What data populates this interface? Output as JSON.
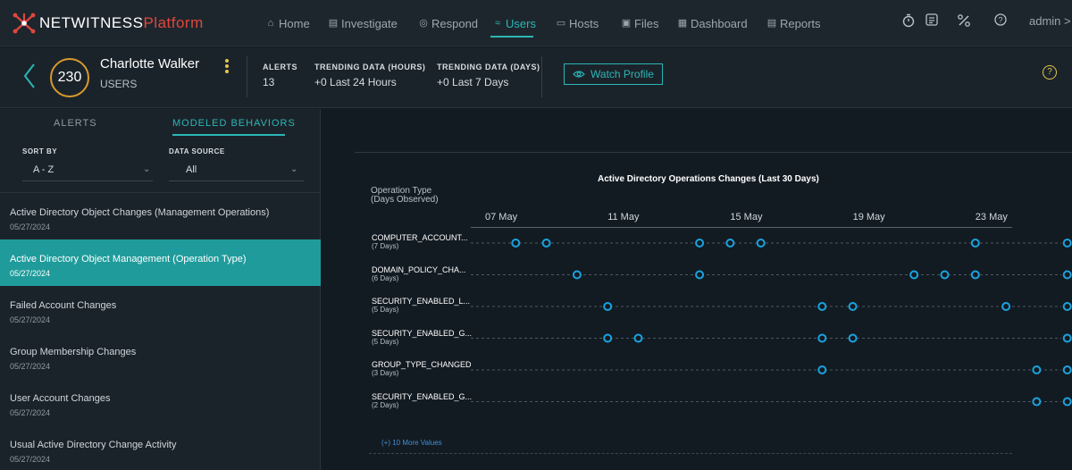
{
  "brand": {
    "name": "NETWITNESS",
    "product": "Platform"
  },
  "nav": [
    {
      "label": "Home",
      "icon": "home-icon",
      "glyph": "⌂"
    },
    {
      "label": "Investigate",
      "icon": "investigate-icon",
      "glyph": "▤"
    },
    {
      "label": "Respond",
      "icon": "respond-icon",
      "glyph": "◎"
    },
    {
      "label": "Users",
      "icon": "users-icon",
      "glyph": "≈"
    },
    {
      "label": "Hosts",
      "icon": "hosts-icon",
      "glyph": "▭"
    },
    {
      "label": "Files",
      "icon": "files-icon",
      "glyph": "▣"
    },
    {
      "label": "Dashboard",
      "icon": "dashboard-icon",
      "glyph": "▦"
    },
    {
      "label": "Reports",
      "icon": "reports-icon",
      "glyph": "▤"
    }
  ],
  "active_nav": "Users",
  "tools": [
    "timer-icon",
    "tasks-icon",
    "tools-icon",
    "help-icon"
  ],
  "admin": "admin >",
  "profile": {
    "score": "230",
    "name": "Charlotte Walker",
    "type": "USERS",
    "stats": [
      {
        "label": "ALERTS",
        "value": "13"
      },
      {
        "label": "TRENDING DATA (HOURS)",
        "value": "+0 Last 24 Hours"
      },
      {
        "label": "TRENDING DATA (DAYS)",
        "value": "+0 Last 7 Days"
      }
    ],
    "watch_label": "Watch Profile",
    "score_color": "#d89a2c"
  },
  "tabs": {
    "alerts": "ALERTS",
    "modeled": "MODELED BEHAVIORS"
  },
  "filters": {
    "sort_label": "SORT BY",
    "sort_value": "A - Z",
    "source_label": "DATA SOURCE",
    "source_value": "All"
  },
  "behaviors": [
    {
      "title": "Active Directory Object Changes (Management Operations)",
      "date": "05/27/2024",
      "selected": false
    },
    {
      "title": "Active Directory Object Management (Operation Type)",
      "date": "05/27/2024",
      "selected": true
    },
    {
      "title": "Failed Account Changes",
      "date": "05/27/2024",
      "selected": false
    },
    {
      "title": "Group Membership Changes",
      "date": "05/27/2024",
      "selected": false
    },
    {
      "title": "User Account Changes",
      "date": "05/27/2024",
      "selected": false
    },
    {
      "title": "Usual Active Directory Change Activity",
      "date": "05/27/2024",
      "selected": false
    }
  ],
  "chart_data": {
    "type": "scatter",
    "title": "Active Directory Operations Changes (Last 30 Days)",
    "ylabel": "Operation Type\n(Days Observed)",
    "x_tick_labels": [
      "07 May",
      "11 May",
      "15 May",
      "19 May",
      "23 May"
    ],
    "x_range": [
      "2024-05-07",
      "2024-05-27"
    ],
    "rows": [
      {
        "name": "COMPUTER_ACCOUNT...",
        "days": "(7 Days)",
        "dates": [
          "2024-05-08",
          "2024-05-09",
          "2024-05-14",
          "2024-05-15",
          "2024-05-16",
          "2024-05-23",
          "2024-05-26"
        ]
      },
      {
        "name": "DOMAIN_POLICY_CHA...",
        "days": "(6 Days)",
        "dates": [
          "2024-05-10",
          "2024-05-14",
          "2024-05-21",
          "2024-05-22",
          "2024-05-23",
          "2024-05-26"
        ]
      },
      {
        "name": "SECURITY_ENABLED_L...",
        "days": "(5 Days)",
        "dates": [
          "2024-05-11",
          "2024-05-18",
          "2024-05-19",
          "2024-05-24",
          "2024-05-26"
        ]
      },
      {
        "name": "SECURITY_ENABLED_G...",
        "days": "(5 Days)",
        "dates": [
          "2024-05-11",
          "2024-05-12",
          "2024-05-18",
          "2024-05-19",
          "2024-05-26"
        ]
      },
      {
        "name": "GROUP_TYPE_CHANGED",
        "days": "(3 Days)",
        "dates": [
          "2024-05-18",
          "2024-05-25",
          "2024-05-26"
        ]
      },
      {
        "name": "SECURITY_ENABLED_G...",
        "days": "(2 Days)",
        "dates": [
          "2024-05-25",
          "2024-05-26"
        ]
      }
    ],
    "more_label": "(+) 10 More Values",
    "marker_color": "#1aa3e0"
  }
}
